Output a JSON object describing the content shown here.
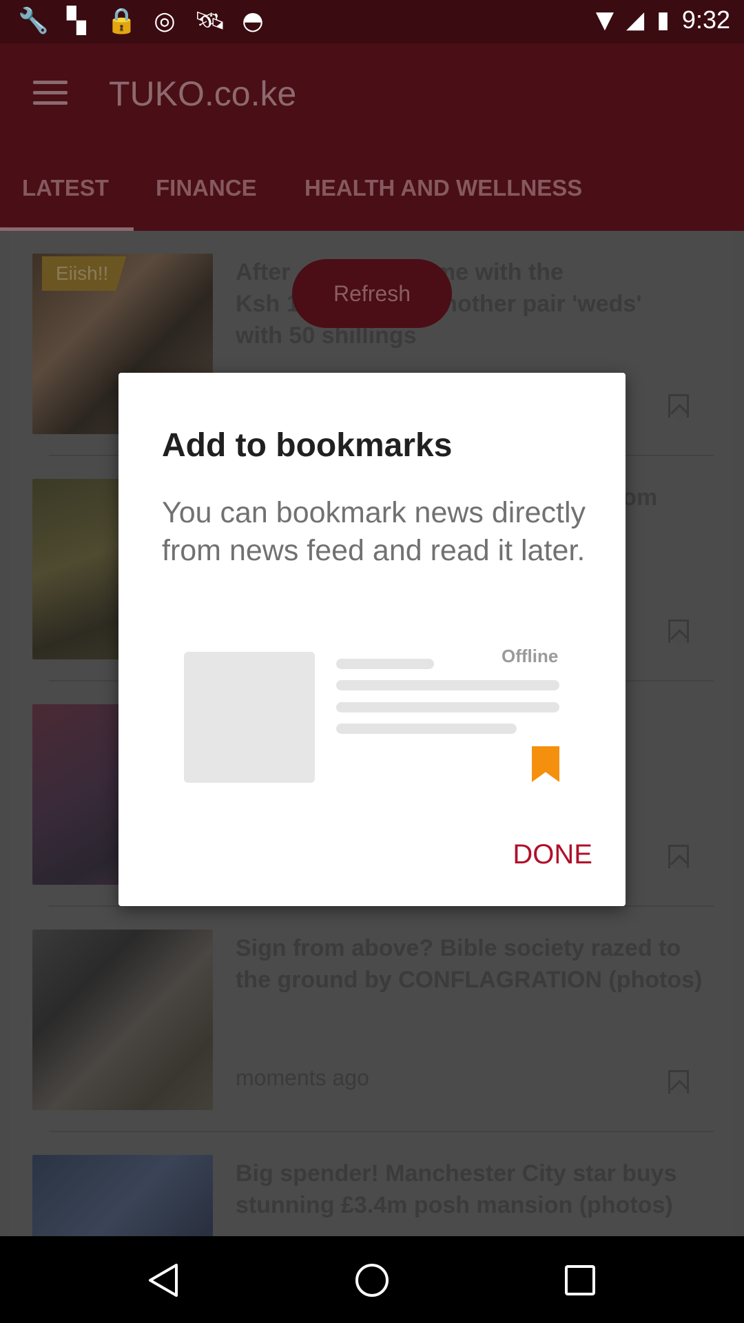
{
  "status_bar": {
    "icons": [
      "wrench-icon",
      "flipboard-icon",
      "lock-icon",
      "data-saver-icon",
      "satellite-icon",
      "android-icon"
    ],
    "time": "9:32"
  },
  "toolbar": {
    "title": "TUKO.co.ke"
  },
  "tabs": [
    {
      "label": "LATEST"
    },
    {
      "label": "FINANCE"
    },
    {
      "label": "HEALTH AND WELLNESS"
    }
  ],
  "feed": {
    "refresh_label": "Refresh",
    "items": [
      {
        "badge": "Eiish!!",
        "headline_visible": [
          "After",
          "that came with the",
          "Ksh 1",
          "et another pair 'weds'",
          "with 50 shillings"
        ]
      },
      {
        "headline_visible": [
          "rom"
        ]
      },
      {},
      {
        "headline": "Sign from above? Bible society razed to the ground by CONFLAGRATION (photos)",
        "time": "moments ago"
      },
      {
        "headline": "Big spender! Manchester City star buys stunning £3.4m posh mansion (photos)"
      }
    ]
  },
  "dialog": {
    "title": "Add to bookmarks",
    "body": "You can bookmark news directly from news feed and read it later.",
    "illustration_label": "Offline",
    "done_label": "DONE"
  },
  "colors": {
    "accent": "#b0102a",
    "bookmark_orange": "#f5900f",
    "toolbar": "#4a0e16"
  }
}
